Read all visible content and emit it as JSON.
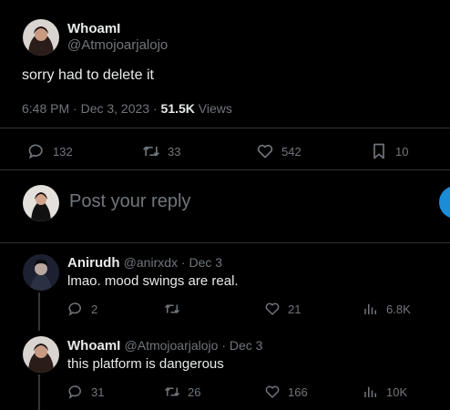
{
  "main_post": {
    "author_name": "WhoamI",
    "author_handle": "@Atmojoarjalojo",
    "text": "sorry had to delete it",
    "timestamp": "6:48 PM · Dec 3, 2023 · ",
    "views_count": "51.5K",
    "views_label": " Views",
    "actions": {
      "replies": "132",
      "reposts": "33",
      "likes": "542",
      "bookmarks": "10"
    }
  },
  "composer": {
    "placeholder": "Post your reply"
  },
  "replies": [
    {
      "author_name": "Anirudh",
      "meta": "@anirxdx · Dec 3",
      "text": "lmao. mood swings are real.",
      "replies": "2",
      "reposts": "",
      "likes": "21",
      "views": "6.8K"
    },
    {
      "author_name": "WhoamI",
      "meta": "@Atmojoarjalojo · Dec 3",
      "text": "this platform is dangerous",
      "replies": "31",
      "reposts": "26",
      "likes": "166",
      "views": "10K"
    }
  ],
  "colors": {
    "background": "#000000",
    "text": "#e7e9ea",
    "muted": "#71767b",
    "divider": "#2f3336",
    "accent": "#1d9bf0"
  },
  "icons": [
    "reply-icon",
    "repost-icon",
    "like-icon",
    "bookmark-icon",
    "views-icon"
  ]
}
